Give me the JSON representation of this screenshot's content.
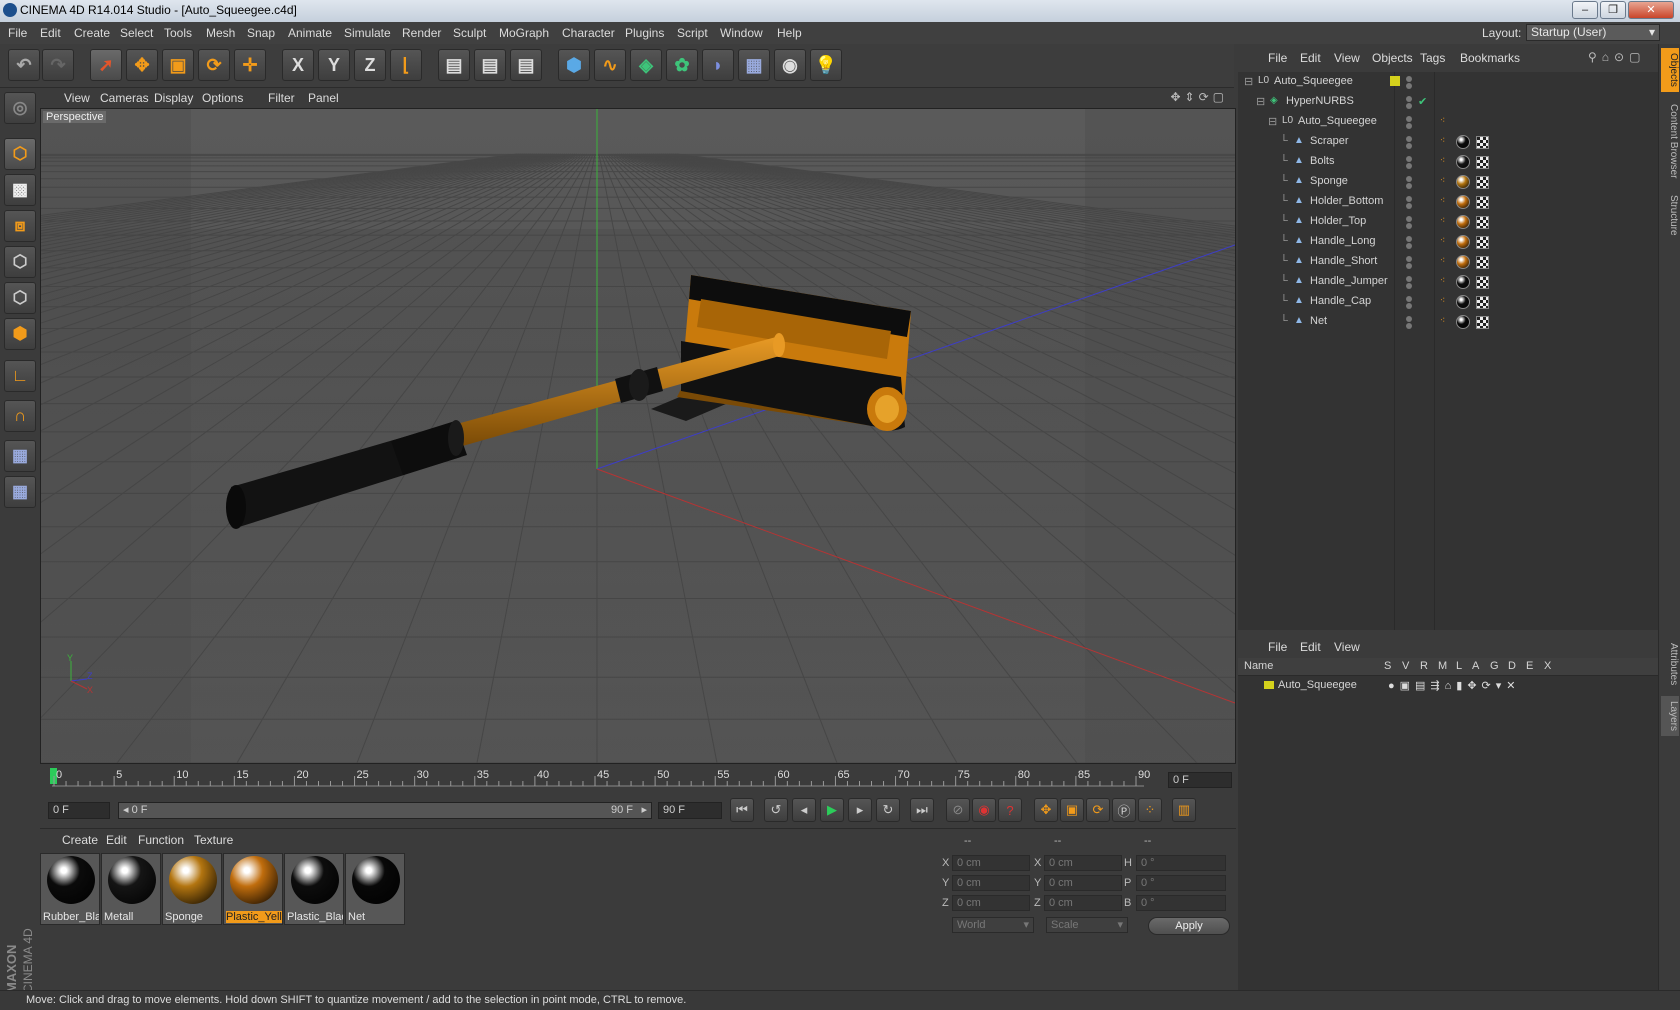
{
  "window": {
    "title": "CINEMA 4D R14.014 Studio - [Auto_Squeegee.c4d]"
  },
  "menu": [
    "File",
    "Edit",
    "Create",
    "Select",
    "Tools",
    "Mesh",
    "Snap",
    "Animate",
    "Simulate",
    "Render",
    "Sculpt",
    "MoGraph",
    "Character",
    "Plugins",
    "Script",
    "Window",
    "Help"
  ],
  "layout": {
    "label": "Layout:",
    "value": "Startup (User)"
  },
  "toolbar": {
    "x_axis": "X",
    "y_axis": "Y",
    "z_axis": "Z"
  },
  "viewport": {
    "menu": [
      "View",
      "Cameras",
      "Display",
      "Options",
      "Filter",
      "Panel"
    ],
    "label": "Perspective",
    "axis_y": "Y",
    "axis_z": "Z",
    "axis_x": "X"
  },
  "timeline": {
    "ticks": [
      "0",
      "5",
      "10",
      "15",
      "20",
      "25",
      "30",
      "35",
      "40",
      "45",
      "50",
      "55",
      "60",
      "65",
      "70",
      "75",
      "80",
      "85",
      "90"
    ],
    "current_frame": "0 F"
  },
  "playback": {
    "start": "0 F",
    "range_start": "0 F",
    "range_end": "90 F",
    "end": "90 F"
  },
  "materials": {
    "menu": [
      "Create",
      "Edit",
      "Function",
      "Texture"
    ],
    "items": [
      {
        "name": "Rubber_Bla",
        "color": "#0b0b0b"
      },
      {
        "name": "Metall",
        "color": "#151515"
      },
      {
        "name": "Sponge",
        "color": "#b37510"
      },
      {
        "name": "Plastic_Yell",
        "color": "#c06d0d"
      },
      {
        "name": "Plastic_Blac",
        "color": "#0d0d0d"
      },
      {
        "name": "Net",
        "color": "#080808"
      }
    ]
  },
  "coordinates": {
    "headers": [
      "--",
      "--",
      "--"
    ],
    "rows": [
      {
        "l1": "X",
        "v1": "0 cm",
        "l2": "X",
        "v2": "0 cm",
        "l3": "H",
        "v3": "0 °"
      },
      {
        "l1": "Y",
        "v1": "0 cm",
        "l2": "Y",
        "v2": "0 cm",
        "l3": "P",
        "v3": "0 °"
      },
      {
        "l1": "Z",
        "v1": "0 cm",
        "l2": "Z",
        "v2": "0 cm",
        "l3": "B",
        "v3": "0 °"
      }
    ],
    "space": "World",
    "mode": "Scale",
    "apply": "Apply"
  },
  "status": "Move: Click and drag to move elements. Hold down SHIFT to quantize movement / add to the selection in point mode, CTRL to remove.",
  "object_manager": {
    "menu": [
      "File",
      "Edit",
      "View",
      "Objects",
      "Tags",
      "Bookmarks"
    ],
    "objects": [
      {
        "name": "Auto_Squeegee",
        "type": "null",
        "level": 0,
        "tags": []
      },
      {
        "name": "HyperNURBS",
        "type": "hypernurbs",
        "level": 1,
        "tags": []
      },
      {
        "name": "Auto_Squeegee",
        "type": "null",
        "level": 2,
        "tags": []
      },
      {
        "name": "Scraper",
        "type": "poly",
        "level": 3,
        "tags": [
          "#0b0b0b"
        ]
      },
      {
        "name": "Bolts",
        "type": "poly",
        "level": 3,
        "tags": [
          "#151515"
        ]
      },
      {
        "name": "Sponge",
        "type": "poly",
        "level": 3,
        "tags": [
          "#b37510"
        ]
      },
      {
        "name": "Holder_Bottom",
        "type": "poly",
        "level": 3,
        "tags": [
          "#c06d0d"
        ]
      },
      {
        "name": "Holder_Top",
        "type": "poly",
        "level": 3,
        "tags": [
          "#c06d0d"
        ]
      },
      {
        "name": "Handle_Long",
        "type": "poly",
        "level": 3,
        "tags": [
          "#c06d0d"
        ]
      },
      {
        "name": "Handle_Short",
        "type": "poly",
        "level": 3,
        "tags": [
          "#c06d0d"
        ]
      },
      {
        "name": "Handle_Jumper",
        "type": "poly",
        "level": 3,
        "tags": [
          "#0d0d0d"
        ]
      },
      {
        "name": "Handle_Cap",
        "type": "poly",
        "level": 3,
        "tags": [
          "#0d0d0d"
        ]
      },
      {
        "name": "Net",
        "type": "poly",
        "level": 3,
        "tags": [
          "#080808"
        ]
      }
    ]
  },
  "layer_manager": {
    "menu": [
      "File",
      "Edit",
      "View"
    ],
    "columns": [
      "Name",
      "S",
      "V",
      "R",
      "M",
      "L",
      "A",
      "G",
      "D",
      "E",
      "X"
    ],
    "layers": [
      {
        "name": "Auto_Squeegee",
        "color": "#d4d11c"
      }
    ]
  },
  "side_tabs": [
    "Objects",
    "Content Browser",
    "Structure",
    "Attributes",
    "Layers"
  ],
  "brand": {
    "line1": "MAXON",
    "line2": "CINEMA 4D"
  },
  "colors": {
    "accent": "#f29b1a",
    "viewport_bg": "#575757"
  }
}
